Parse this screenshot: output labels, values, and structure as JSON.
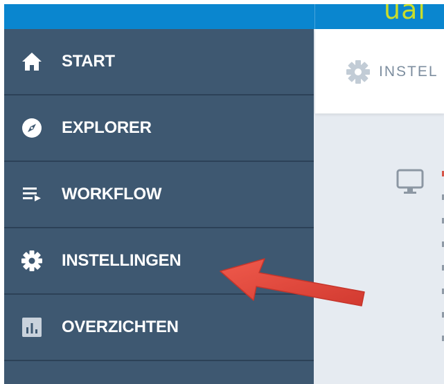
{
  "topbar": {
    "logo_text": "ual",
    "background_color": "#0a86cf",
    "logo_color": "#c9dd2a"
  },
  "sidebar": {
    "background_color": "#3e5871",
    "items": [
      {
        "label": "START",
        "icon": "home-icon"
      },
      {
        "label": "EXPLORER",
        "icon": "compass-icon"
      },
      {
        "label": "WORKFLOW",
        "icon": "workflow-icon"
      },
      {
        "label": "INSTELLINGEN",
        "icon": "gear-icon"
      },
      {
        "label": "OVERZICHTEN",
        "icon": "bar-chart-icon"
      }
    ]
  },
  "main": {
    "header_title": "INSTEL",
    "header_icon": "gear-icon",
    "content_icon": "monitor-icon",
    "background_color": "#e6ebf1"
  },
  "annotation": {
    "arrow_color": "#e0443a",
    "points_to": "INSTELLINGEN"
  }
}
